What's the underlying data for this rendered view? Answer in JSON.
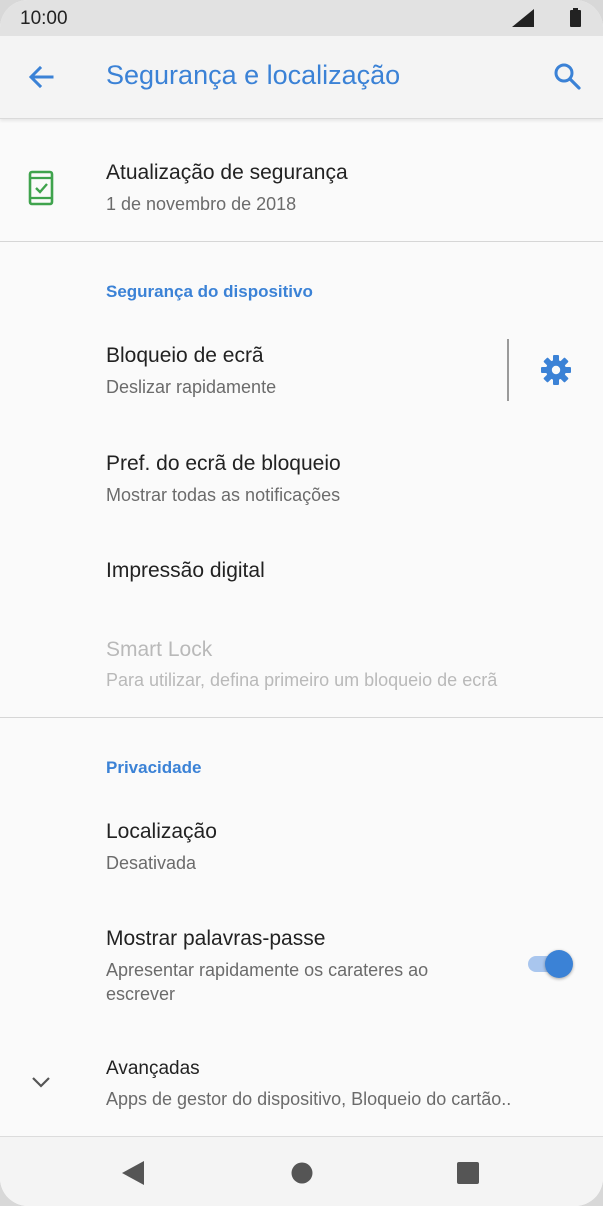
{
  "status_bar": {
    "time": "10:00"
  },
  "app_bar": {
    "title": "Segurança e localização"
  },
  "security_update": {
    "title": "Atualização de segurança",
    "summary": "1 de novembro de 2018"
  },
  "device_security": {
    "header": "Segurança do dispositivo",
    "screen_lock": {
      "title": "Bloqueio de ecrã",
      "summary": "Deslizar rapidamente"
    },
    "lock_screen_prefs": {
      "title": "Pref. do ecrã de bloqueio",
      "summary": "Mostrar todas as notificações"
    },
    "fingerprint": {
      "title": "Impressão digital"
    },
    "smart_lock": {
      "title": "Smart Lock",
      "summary": "Para utilizar, defina primeiro um bloqueio de ecrã"
    }
  },
  "privacy": {
    "header": "Privacidade",
    "location": {
      "title": "Localização",
      "summary": "Desativada"
    },
    "show_passwords": {
      "title": "Mostrar palavras-passe",
      "summary_line1": "Apresentar rapidamente os carateres ao",
      "summary_line2": "escrever",
      "enabled": true
    }
  },
  "advanced": {
    "title": "Avançadas",
    "summary": "Apps de gestor do dispositivo, Bloqueio do cartão.."
  },
  "colors": {
    "accent": "#3b82d6",
    "icon_green": "#3fa34d",
    "text": "#222222",
    "secondary_text": "#6b6b6b"
  },
  "icons": [
    "signal-icon",
    "battery-icon",
    "back-icon",
    "search-icon",
    "shield-phone-icon",
    "gear-icon",
    "chevron-down-icon",
    "nav-back-icon",
    "nav-home-icon",
    "nav-recents-icon"
  ]
}
